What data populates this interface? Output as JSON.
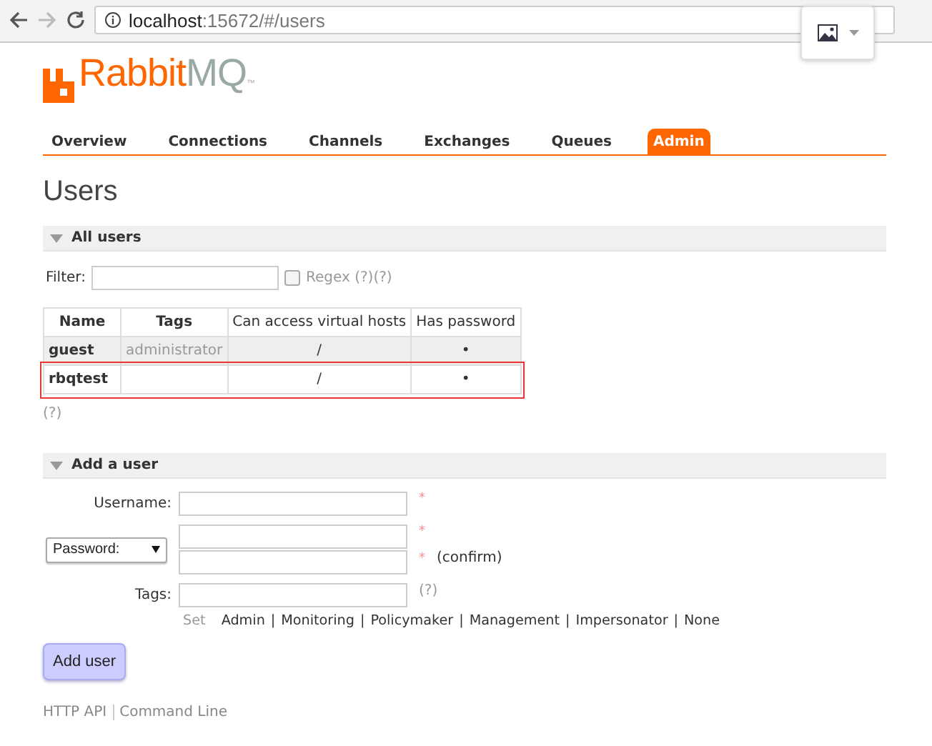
{
  "browser": {
    "url_host": "localhost",
    "url_rest": ":15672/#/users"
  },
  "logo": {
    "name": "Rabbit",
    "suffix": "MQ",
    "mark": "™"
  },
  "tabs": [
    {
      "label": "Overview",
      "selected": false
    },
    {
      "label": "Connections",
      "selected": false
    },
    {
      "label": "Channels",
      "selected": false
    },
    {
      "label": "Exchanges",
      "selected": false
    },
    {
      "label": "Queues",
      "selected": false
    },
    {
      "label": "Admin",
      "selected": true
    }
  ],
  "page_title": "Users",
  "all_users": {
    "title": "All users",
    "expanded": true,
    "filter_label": "Filter:",
    "regex_label": "Regex",
    "regex_checked": false,
    "regex_help": [
      "(?)",
      "(?)"
    ],
    "table": {
      "columns": [
        "Name",
        "Tags",
        "Can access virtual hosts",
        "Has password"
      ],
      "rows": [
        {
          "name": "guest",
          "tags": "administrator",
          "vhosts": "/",
          "has_password": "•",
          "highlighted": false
        },
        {
          "name": "rbqtest",
          "tags": "",
          "vhosts": "/",
          "has_password": "•",
          "highlighted": true
        }
      ]
    },
    "help": "(?)"
  },
  "add_user": {
    "title": "Add a user",
    "expanded": true,
    "username_label": "Username:",
    "username_required": "*",
    "password_select": "Password:",
    "password_required": "*",
    "confirm_required": "*",
    "confirm_label": "(confirm)",
    "tags_label": "Tags:",
    "tags_help": "(?)",
    "set_label": "Set",
    "tag_links": [
      "Admin",
      "Monitoring",
      "Policymaker",
      "Management",
      "Impersonator",
      "None"
    ],
    "separator": "|",
    "button": "Add user"
  },
  "footer": {
    "links": [
      "HTTP API",
      "Command Line"
    ]
  }
}
